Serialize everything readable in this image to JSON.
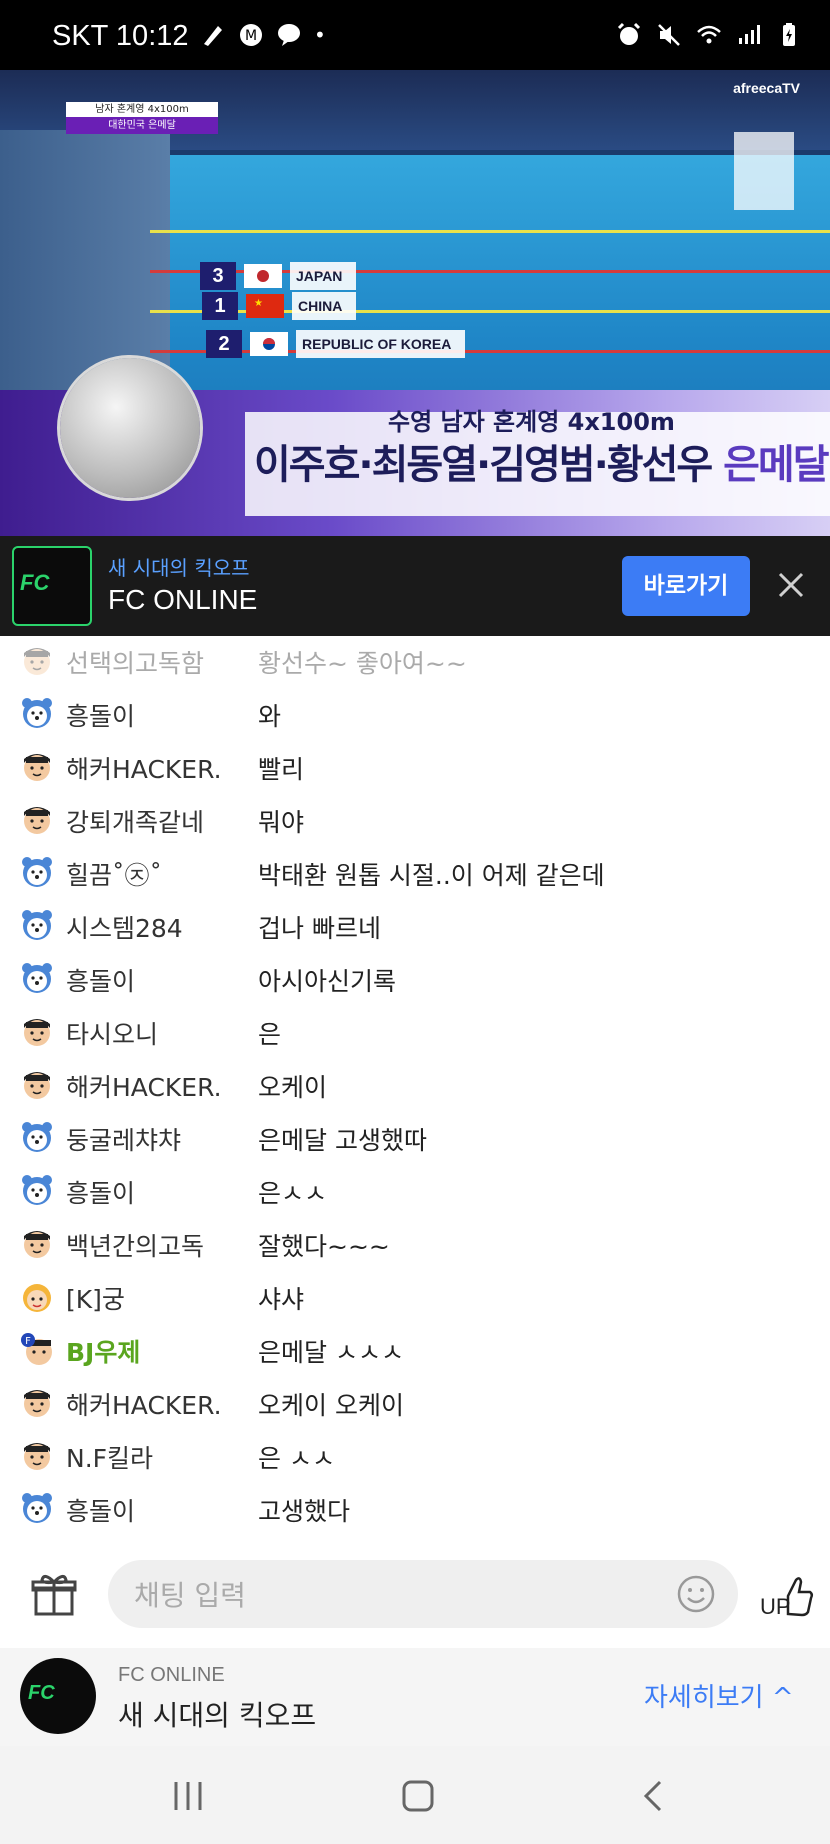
{
  "status_bar": {
    "carrier_time": "SKT 10:12",
    "dot": "•",
    "left_icons": [
      "quill-icon",
      "m-circle-icon",
      "chat-bubble-icon"
    ],
    "right_icons": [
      "alarm-icon",
      "mute-icon",
      "wifi-icon",
      "signal-icon",
      "battery-charging-icon"
    ]
  },
  "video": {
    "score_top": "남자 혼계영 4x100m",
    "score_bottom": "대한민국 은메달",
    "broadcaster": "afreecaTV",
    "results": [
      {
        "rank": "3",
        "country": "JAPAN"
      },
      {
        "rank": "1",
        "country": "CHINA"
      },
      {
        "rank": "2",
        "country": "REPUBLIC OF KOREA"
      }
    ],
    "banner_line1": "수영 남자 혼계영 4x100m",
    "banner_names": "이주호·최동열·김영범·황선우",
    "banner_medal": "은메달"
  },
  "ad_top": {
    "logo_text": "FC",
    "subtitle": "새 시대의 킥오프",
    "title": "FC ONLINE",
    "button": "바로가기",
    "close_icon": "close-icon"
  },
  "chat": {
    "messages": [
      {
        "nick": "선택의고독함",
        "text": "황선수~ 좋아여~~",
        "avatar": "person",
        "faded": true
      },
      {
        "nick": "흥돌이",
        "text": "와",
        "avatar": "bear"
      },
      {
        "nick": "해커HACKER.",
        "text": "빨리",
        "avatar": "person"
      },
      {
        "nick": "강퇴개족같네",
        "text": "뭐야",
        "avatar": "person"
      },
      {
        "nick": "힐끔˚㉨˚",
        "text": "박태환 원톱 시절..이 어제 같은데",
        "avatar": "bear"
      },
      {
        "nick": "시스템284",
        "text": "겁나 빠르네",
        "avatar": "bear"
      },
      {
        "nick": "흥돌이",
        "text": "아시아신기록",
        "avatar": "bear"
      },
      {
        "nick": "타시오니",
        "text": "은",
        "avatar": "person"
      },
      {
        "nick": "해커HACKER.",
        "text": "오케이",
        "avatar": "person"
      },
      {
        "nick": "둥굴레챠챠",
        "text": "은메달 고생했따",
        "avatar": "bear"
      },
      {
        "nick": "흥돌이",
        "text": "은ㅅㅅ",
        "avatar": "bear"
      },
      {
        "nick": "백년간의고독",
        "text": "잘했다~~~",
        "avatar": "person"
      },
      {
        "nick": "[K]궁",
        "text": "샤샤",
        "avatar": "girl"
      },
      {
        "nick": "BJ우제",
        "text": "은메달 ㅅㅅㅅ",
        "avatar": "bj"
      },
      {
        "nick": "해커HACKER.",
        "text": "오케이 오케이",
        "avatar": "person"
      },
      {
        "nick": "N.F킬라",
        "text": "은 ㅅㅅ",
        "avatar": "person"
      },
      {
        "nick": "흥돌이",
        "text": "고생했다",
        "avatar": "bear"
      }
    ]
  },
  "input_bar": {
    "placeholder": "채팅 입력",
    "gift_icon": "gift-icon",
    "emoji_icon": "smiley-icon",
    "up_label": "UP"
  },
  "promo": {
    "logo_text": "FC",
    "brand": "FC ONLINE",
    "title": "새 시대의 킥오프",
    "more": "자세히보기 ^"
  },
  "nav": {
    "icons": [
      "recent-apps-icon",
      "home-icon",
      "back-icon"
    ]
  }
}
